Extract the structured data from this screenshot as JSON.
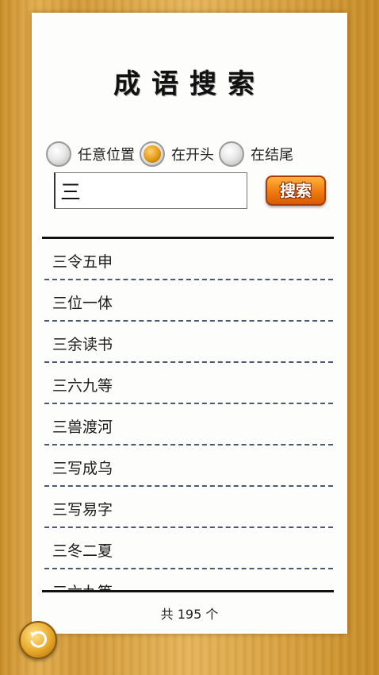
{
  "title": "成语搜索",
  "search_mode": {
    "options": [
      {
        "label": "任意位置",
        "selected": false
      },
      {
        "label": "在开头",
        "selected": true
      },
      {
        "label": "在结尾",
        "selected": false
      }
    ]
  },
  "search": {
    "value": "三",
    "button_label": "搜索"
  },
  "results": {
    "items": [
      "三令五申",
      "三位一体",
      "三余读书",
      "三六九等",
      "三兽渡河",
      "三写成乌",
      "三写易字",
      "三冬二夏",
      "三六九等"
    ],
    "count_label": "共 195 个"
  },
  "icons": {
    "back": "back-arrow-icon"
  },
  "colors": {
    "accent": "#e08a10",
    "wood": "#d9a443"
  }
}
